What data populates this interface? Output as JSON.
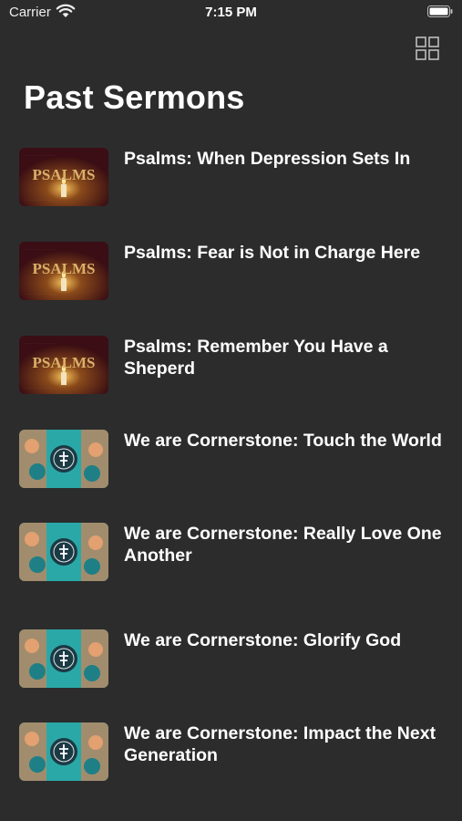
{
  "status_bar": {
    "carrier": "Carrier",
    "time": "7:15 PM"
  },
  "header": {
    "title": "Past Sermons"
  },
  "thumbnail_series": {
    "psalms": {
      "text": "PSALMS"
    }
  },
  "sermons": [
    {
      "title": "Psalms: When Depression Sets In",
      "series": "psalms"
    },
    {
      "title": "Psalms: Fear is Not in Charge Here",
      "series": "psalms"
    },
    {
      "title": "Psalms: Remember You Have a Sheperd",
      "series": "psalms"
    },
    {
      "title": "We are Cornerstone: Touch the World",
      "series": "cornerstone"
    },
    {
      "title": "We are Cornerstone: Really Love One Another",
      "series": "cornerstone"
    },
    {
      "title": "We are Cornerstone: Glorify God",
      "series": "cornerstone"
    },
    {
      "title": "We are Cornerstone: Impact the Next Generation",
      "series": "cornerstone"
    }
  ],
  "colors": {
    "background": "#2c2c2c",
    "text": "#ffffff"
  }
}
